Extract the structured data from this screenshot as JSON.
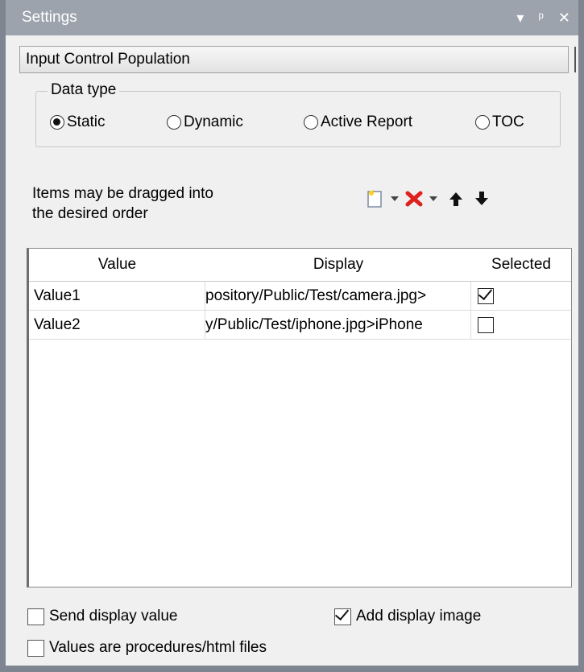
{
  "titlebar": {
    "title": "Settings",
    "dropdown_icon": "▾",
    "pin_icon": "⫫",
    "close_icon": "✕"
  },
  "section": {
    "title": "Input Control Population"
  },
  "data_type": {
    "legend": "Data type",
    "options": [
      {
        "label": "Static",
        "selected": true
      },
      {
        "label": "Dynamic",
        "selected": false
      },
      {
        "label": "Active Report",
        "selected": false
      },
      {
        "label": "TOC",
        "selected": false
      }
    ]
  },
  "hint": {
    "line1": "Items may be dragged into",
    "line2": "the desired order"
  },
  "toolbar": [
    "new-item-icon",
    "delete-icon",
    "move-up-icon",
    "move-down-icon"
  ],
  "grid": {
    "columns": [
      "Value",
      "Display",
      "Selected"
    ],
    "rows": [
      {
        "value": "Value1",
        "display": "IBFS:/WFC/Repository/Public/Test/camera.jpg>",
        "display_visible": "pository/Public/Test/camera.jpg>",
        "selected": true
      },
      {
        "value": "Value2",
        "display": "y/Public/Test/iphone.jpg>iPhone",
        "display_visible": "y/Public/Test/iphone.jpg>iPhone",
        "selected": false
      }
    ]
  },
  "options": {
    "send_display_value": {
      "label": "Send display value",
      "checked": false
    },
    "add_display_image": {
      "label": "Add display image",
      "checked": true
    },
    "values_are_procedures": {
      "label": "Values are procedures/html files",
      "checked": false
    }
  },
  "colors": {
    "titlebar": "#9ca3ad",
    "border": "#7f8590",
    "background": "#f0f0f0",
    "delete": "#e0201c"
  }
}
